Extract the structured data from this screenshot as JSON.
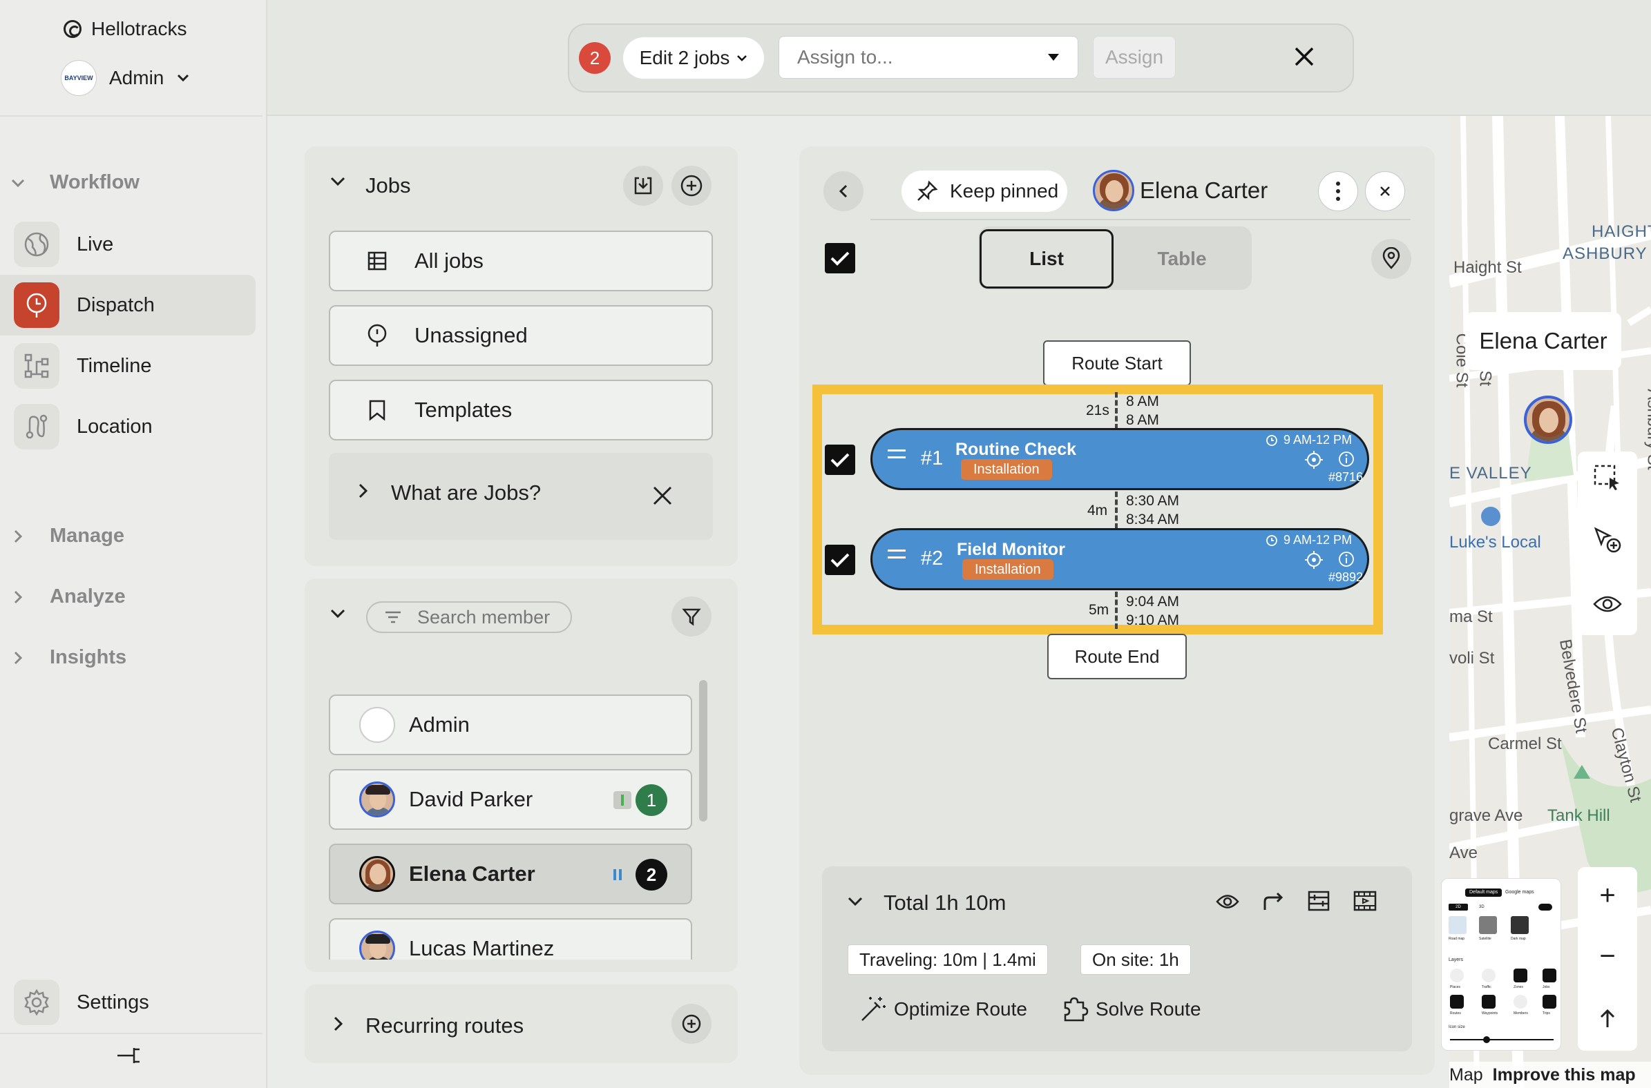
{
  "app": {
    "name": "Hellotracks",
    "account": "Admin",
    "account_logo_text": "BAYVIEW"
  },
  "nav": {
    "workflow_label": "Workflow",
    "items": [
      {
        "label": "Live",
        "icon": "globe-icon"
      },
      {
        "label": "Dispatch",
        "icon": "dispatch-icon"
      },
      {
        "label": "Timeline",
        "icon": "timeline-icon"
      },
      {
        "label": "Location",
        "icon": "location-icon"
      }
    ],
    "sections": [
      "Manage",
      "Analyze",
      "Insights"
    ],
    "settings": "Settings"
  },
  "topbar": {
    "selected_count": "2",
    "edit_label": "Edit 2 jobs",
    "assign_placeholder": "Assign to...",
    "assign_button": "Assign"
  },
  "jobs": {
    "header": "Jobs",
    "buttons": [
      "All jobs",
      "Unassigned",
      "Templates"
    ],
    "what_are_jobs": "What are Jobs?"
  },
  "members": {
    "search_placeholder": "Search member",
    "list": [
      {
        "name": "Admin",
        "count": ""
      },
      {
        "name": "David Parker",
        "count": "1"
      },
      {
        "name": "Elena Carter",
        "count": "2"
      },
      {
        "name": "Lucas Martinez",
        "count": ""
      }
    ]
  },
  "recurring": {
    "label": "Recurring routes"
  },
  "route": {
    "keep_pinned": "Keep pinned",
    "member_name": "Elena Carter",
    "view_list": "List",
    "view_table": "Table",
    "route_start": "Route Start",
    "route_end": "Route End",
    "segments": [
      {
        "duration": "21s",
        "t1": "8 AM",
        "t2": "8 AM"
      },
      {
        "duration": "4m",
        "t1": "8:30 AM",
        "t2": "8:34 AM"
      },
      {
        "duration": "5m",
        "t1": "9:04 AM",
        "t2": "9:10 AM"
      }
    ],
    "jobs": [
      {
        "num": "#1",
        "title": "Routine Check",
        "tag": "Installation",
        "window": "9 AM-12 PM",
        "ref": "#8716"
      },
      {
        "num": "#2",
        "title": "Field Monitor",
        "tag": "Installation",
        "window": "9 AM-12 PM",
        "ref": "#9892"
      }
    ],
    "summary": {
      "total": "Total 1h 10m",
      "traveling": "Traveling: 10m | 1.4mi",
      "on_site": "On site: 1h",
      "optimize": "Optimize Route",
      "solve": "Solve Route"
    }
  },
  "map": {
    "tooltip": "Elena Carter",
    "labels": [
      "HAIGHT-",
      "ASHBURY",
      "Haight St",
      "Cole St",
      "Ashbury St",
      "E VALLEY",
      "Luke's Local",
      "ma St",
      "voli St",
      "Belvedere St",
      "Carmel St",
      "Clayton St",
      "grave Ave",
      "Tank Hill",
      "Ave",
      "St"
    ],
    "footer_map": "Map",
    "footer_improve": "Improve this map",
    "zoom_in": "+",
    "zoom_out": "−",
    "layers_panel": {
      "tab_default": "Default maps",
      "tab_google": "Google maps",
      "mode_2d": "2D",
      "mode_3d": "3D",
      "styles": [
        "Road map",
        "Satellite",
        "Dark map"
      ],
      "layers_title": "Layers",
      "layers": [
        "Places",
        "Traffic",
        "Zones",
        "Jobs",
        "Routes",
        "Waypoints",
        "Members",
        "Trips"
      ],
      "icon_size": "Icon size"
    }
  }
}
